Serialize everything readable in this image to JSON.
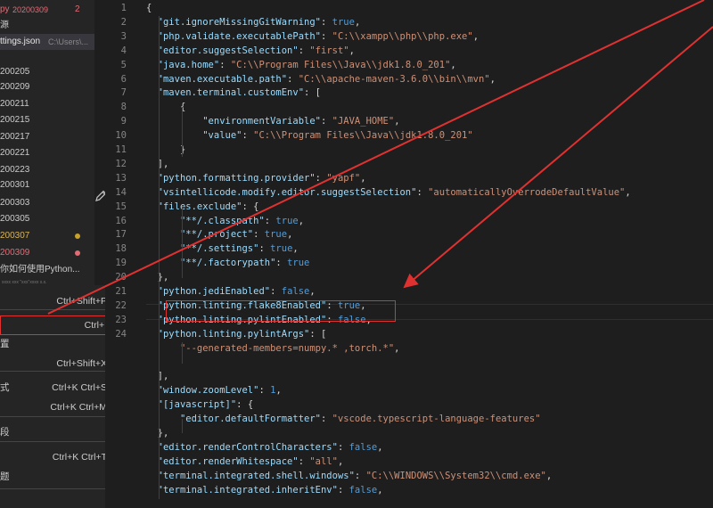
{
  "sidebar": {
    "rows": [
      {
        "text": "py",
        "hint": "20200309",
        "count": "2",
        "style": "modified"
      },
      {
        "text": "源",
        "hint": "",
        "style": "normal"
      },
      {
        "text": "ttings.json",
        "hint": "C:\\Users\\...",
        "style": "active"
      },
      {
        "text": "200205",
        "hint": "",
        "style": "normal"
      },
      {
        "text": "200209",
        "hint": "",
        "style": "normal"
      },
      {
        "text": "200211",
        "hint": "",
        "style": "normal"
      },
      {
        "text": "200215",
        "hint": "",
        "style": "normal"
      },
      {
        "text": "200217",
        "hint": "",
        "style": "normal"
      },
      {
        "text": "200221",
        "hint": "",
        "style": "normal"
      },
      {
        "text": "200223",
        "hint": "",
        "style": "normal"
      },
      {
        "text": "200301",
        "hint": "",
        "style": "normal"
      },
      {
        "text": "200303",
        "hint": "",
        "style": "normal"
      },
      {
        "text": "200305",
        "hint": "",
        "style": "normal"
      },
      {
        "text": "200307",
        "hint": "",
        "style": "yellow",
        "dot": "#c9a227"
      },
      {
        "text": "200309",
        "hint": "",
        "style": "red",
        "dot": "#e06c75"
      },
      {
        "text": "你如何使用Python...",
        "hint": "",
        "style": "normal"
      }
    ],
    "tiny_text": "xxxx xxx \"xxx\"xxxx x.x."
  },
  "menu": {
    "items": [
      {
        "label": "",
        "shortcut": "Ctrl+Shift+P"
      },
      {
        "label": "",
        "shortcut": "Ctrl+,"
      },
      {
        "label": "置",
        "shortcut": ""
      },
      {
        "label": "",
        "shortcut": "Ctrl+Shift+X"
      },
      {
        "label": "式",
        "shortcut": "Ctrl+K Ctrl+S"
      },
      {
        "label": "",
        "shortcut": "Ctrl+K Ctrl+M"
      },
      {
        "label": "段",
        "shortcut": ""
      },
      {
        "label": "",
        "shortcut": "Ctrl+K Ctrl+T"
      },
      {
        "label": "题",
        "shortcut": ""
      }
    ]
  },
  "editor": {
    "line_numbers": [
      "1",
      "2",
      "3",
      "4",
      "5",
      "6",
      "7",
      "8",
      "9",
      "10",
      "11",
      "12",
      "13",
      "14",
      "15",
      "16",
      "17",
      "18",
      "19",
      "20",
      "21",
      "22",
      "23",
      "24"
    ],
    "lines": [
      {
        "t": [
          {
            "c": "p",
            "v": "{"
          }
        ]
      },
      {
        "t": [
          {
            "c": "k",
            "v": "\"git.ignoreMissingGitWarning\""
          },
          {
            "c": "p",
            "v": ": "
          },
          {
            "c": "b",
            "v": "true"
          },
          {
            "c": "p",
            "v": ","
          }
        ]
      },
      {
        "t": [
          {
            "c": "k",
            "v": "\"php.validate.executablePath\""
          },
          {
            "c": "p",
            "v": ": "
          },
          {
            "c": "s",
            "v": "\"C:\\\\xampp\\\\php\\\\php.exe\""
          },
          {
            "c": "p",
            "v": ","
          }
        ]
      },
      {
        "t": [
          {
            "c": "k",
            "v": "\"editor.suggestSelection\""
          },
          {
            "c": "p",
            "v": ": "
          },
          {
            "c": "s",
            "v": "\"first\""
          },
          {
            "c": "p",
            "v": ","
          }
        ]
      },
      {
        "t": [
          {
            "c": "k",
            "v": "\"java.home\""
          },
          {
            "c": "p",
            "v": ": "
          },
          {
            "c": "s",
            "v": "\"C:\\\\Program Files\\\\Java\\\\jdk1.8.0_201\""
          },
          {
            "c": "p",
            "v": ","
          }
        ]
      },
      {
        "t": [
          {
            "c": "k",
            "v": "\"maven.executable.path\""
          },
          {
            "c": "p",
            "v": ": "
          },
          {
            "c": "s",
            "v": "\"C:\\\\apache-maven-3.6.0\\\\bin\\\\mvn\""
          },
          {
            "c": "p",
            "v": ","
          }
        ]
      },
      {
        "t": [
          {
            "c": "k",
            "v": "\"maven.terminal.customEnv\""
          },
          {
            "c": "p",
            "v": ": ["
          }
        ]
      },
      {
        "t": [
          {
            "c": "p",
            "v": "    {"
          }
        ]
      },
      {
        "t": [
          {
            "c": "k",
            "v": "        \"environmentVariable\""
          },
          {
            "c": "p",
            "v": ": "
          },
          {
            "c": "s",
            "v": "\"JAVA_HOME\""
          },
          {
            "c": "p",
            "v": ","
          }
        ]
      },
      {
        "t": [
          {
            "c": "k",
            "v": "        \"value\""
          },
          {
            "c": "p",
            "v": ": "
          },
          {
            "c": "s",
            "v": "\"C:\\\\Program Files\\\\Java\\\\jdk1.8.0_201\""
          }
        ]
      },
      {
        "t": [
          {
            "c": "p",
            "v": "    }"
          }
        ]
      },
      {
        "t": [
          {
            "c": "p",
            "v": "],"
          }
        ]
      },
      {
        "t": [
          {
            "c": "k",
            "v": "\"python.formatting.provider\""
          },
          {
            "c": "p",
            "v": ": "
          },
          {
            "c": "s",
            "v": "\"yapf\""
          },
          {
            "c": "p",
            "v": ","
          }
        ]
      },
      {
        "t": [
          {
            "c": "k",
            "v": "\"vsintellicode.modify.editor.suggestSelection\""
          },
          {
            "c": "p",
            "v": ": "
          },
          {
            "c": "s",
            "v": "\"automaticallyOverrodeDefaultValue\""
          },
          {
            "c": "p",
            "v": ","
          }
        ]
      },
      {
        "t": [
          {
            "c": "k",
            "v": "\"files.exclude\""
          },
          {
            "c": "p",
            "v": ": {"
          }
        ]
      },
      {
        "t": [
          {
            "c": "k",
            "v": "    \"**/.classpath\""
          },
          {
            "c": "p",
            "v": ": "
          },
          {
            "c": "b",
            "v": "true"
          },
          {
            "c": "p",
            "v": ","
          }
        ]
      },
      {
        "t": [
          {
            "c": "k",
            "v": "    \"**/.project\""
          },
          {
            "c": "p",
            "v": ": "
          },
          {
            "c": "b",
            "v": "true"
          },
          {
            "c": "p",
            "v": ","
          }
        ]
      },
      {
        "t": [
          {
            "c": "k",
            "v": "    \"**/.settings\""
          },
          {
            "c": "p",
            "v": ": "
          },
          {
            "c": "b",
            "v": "true"
          },
          {
            "c": "p",
            "v": ","
          }
        ]
      },
      {
        "t": [
          {
            "c": "k",
            "v": "    \"**/.factorypath\""
          },
          {
            "c": "p",
            "v": ": "
          },
          {
            "c": "b",
            "v": "true"
          }
        ]
      },
      {
        "t": [
          {
            "c": "p",
            "v": "},"
          }
        ]
      },
      {
        "t": [
          {
            "c": "k",
            "v": "\"python.jediEnabled\""
          },
          {
            "c": "p",
            "v": ": "
          },
          {
            "c": "b",
            "v": "false"
          },
          {
            "c": "p",
            "v": ","
          }
        ]
      },
      {
        "t": [
          {
            "c": "k",
            "v": "\"python.linting.flake8Enabled\""
          },
          {
            "c": "p",
            "v": ": "
          },
          {
            "c": "b",
            "v": "true"
          },
          {
            "c": "p",
            "v": ","
          }
        ]
      },
      {
        "t": [
          {
            "c": "k",
            "v": "\"python.linting.pylintEnabled\""
          },
          {
            "c": "p",
            "v": ": "
          },
          {
            "c": "b",
            "v": "false"
          },
          {
            "c": "p",
            "v": ","
          }
        ]
      },
      {
        "t": [
          {
            "c": "k",
            "v": "\"python.linting.pylintArgs\""
          },
          {
            "c": "p",
            "v": ": ["
          }
        ]
      },
      {
        "t": [
          {
            "c": "s",
            "v": "    \"--generated-members=numpy.* ,torch.*\""
          },
          {
            "c": "p",
            "v": ","
          }
        ]
      },
      {
        "t": []
      },
      {
        "t": [
          {
            "c": "p",
            "v": "],"
          }
        ]
      },
      {
        "t": [
          {
            "c": "k",
            "v": "\"window.zoomLevel\""
          },
          {
            "c": "p",
            "v": ": "
          },
          {
            "c": "b",
            "v": "1"
          },
          {
            "c": "p",
            "v": ","
          }
        ]
      },
      {
        "t": [
          {
            "c": "k",
            "v": "\"[javascript]\""
          },
          {
            "c": "p",
            "v": ": {"
          }
        ]
      },
      {
        "t": [
          {
            "c": "k",
            "v": "    \"editor.defaultFormatter\""
          },
          {
            "c": "p",
            "v": ": "
          },
          {
            "c": "s",
            "v": "\"vscode.typescript-language-features\""
          }
        ]
      },
      {
        "t": [
          {
            "c": "p",
            "v": "},"
          }
        ]
      },
      {
        "t": [
          {
            "c": "k",
            "v": "\"editor.renderControlCharacters\""
          },
          {
            "c": "p",
            "v": ": "
          },
          {
            "c": "b",
            "v": "false"
          },
          {
            "c": "p",
            "v": ","
          }
        ]
      },
      {
        "t": [
          {
            "c": "k",
            "v": "\"editor.renderWhitespace\""
          },
          {
            "c": "p",
            "v": ": "
          },
          {
            "c": "s",
            "v": "\"all\""
          },
          {
            "c": "p",
            "v": ","
          }
        ]
      },
      {
        "t": [
          {
            "c": "k",
            "v": "\"terminal.integrated.shell.windows\""
          },
          {
            "c": "p",
            "v": ": "
          },
          {
            "c": "s",
            "v": "\"C:\\\\WINDOWS\\\\System32\\\\cmd.exe\""
          },
          {
            "c": "p",
            "v": ","
          }
        ]
      },
      {
        "t": [
          {
            "c": "k",
            "v": "\"terminal.integrated.inheritEnv\""
          },
          {
            "c": "p",
            "v": ": "
          },
          {
            "c": "b",
            "v": "false"
          },
          {
            "c": "p",
            "v": ","
          }
        ]
      }
    ]
  },
  "colors": {
    "annotation": "#e03131",
    "key": "#9cdcfe",
    "string": "#ce9178",
    "keyword": "#569cd6"
  }
}
